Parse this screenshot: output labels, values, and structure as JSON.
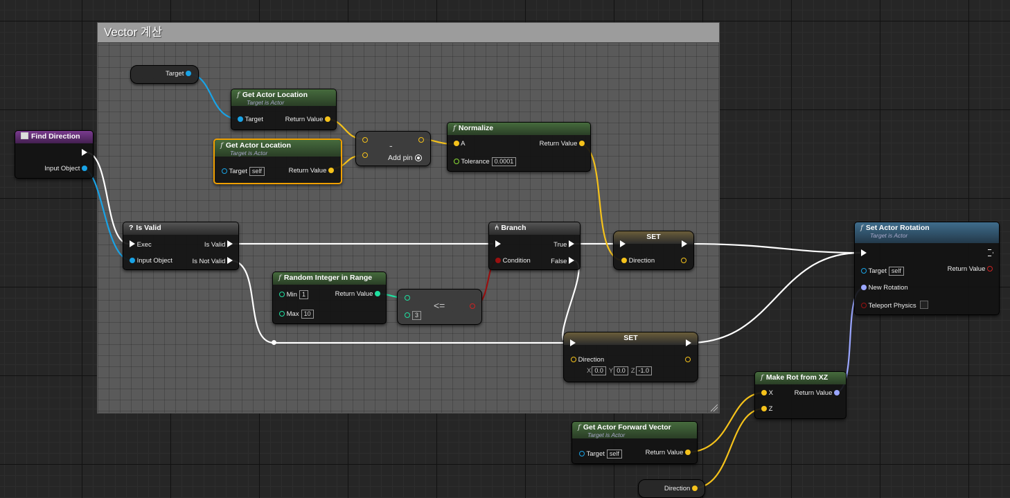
{
  "comment": {
    "title": "Vector 계산"
  },
  "colors": {
    "exec": "#ffffff",
    "object": "#19a3e6",
    "vector": "#f5c21b",
    "bool": "#9a1010",
    "int": "#1fe0a0",
    "float": "#8ce035",
    "rotator": "#9aa6ff"
  },
  "nodes": {
    "find_direction": {
      "title": "Find Direction",
      "input_object": "Input Object"
    },
    "target_var": {
      "label": "Target"
    },
    "get_loc_1": {
      "title": "Get Actor Location",
      "subtitle": "Target is Actor",
      "target": "Target",
      "ret": "Return Value"
    },
    "get_loc_2": {
      "title": "Get Actor Location",
      "subtitle": "Target is Actor",
      "target": "Target",
      "target_val": "self",
      "ret": "Return Value"
    },
    "subtract": {
      "op": "-",
      "add_pin": "Add pin"
    },
    "normalize": {
      "title": "Normalize",
      "a": "A",
      "ret": "Return Value",
      "tolerance": "Tolerance",
      "tolerance_val": "0.0001"
    },
    "is_valid": {
      "title": "Is Valid",
      "exec": "Exec",
      "is_valid": "Is Valid",
      "input_object": "Input Object",
      "is_not_valid": "Is Not Valid"
    },
    "branch": {
      "title": "Branch",
      "true": "True",
      "condition": "Condition",
      "false": "False"
    },
    "set1": {
      "title": "SET",
      "direction": "Direction"
    },
    "random_int": {
      "title": "Random Integer in Range",
      "min": "Min",
      "min_val": "1",
      "ret": "Return Value",
      "max": "Max",
      "max_val": "10"
    },
    "lte": {
      "op": "<=",
      "b_val": "3"
    },
    "set2": {
      "title": "SET",
      "direction": "Direction",
      "x": "X",
      "x_val": "0.0",
      "y": "Y",
      "y_val": "0.0",
      "z": "Z",
      "z_val": "-1.0"
    },
    "set_rotation": {
      "title": "Set Actor Rotation",
      "subtitle": "Target is Actor",
      "target": "Target",
      "target_val": "self",
      "ret": "Return Value",
      "new_rotation": "New Rotation",
      "teleport": "Teleport Physics"
    },
    "make_rot": {
      "title": "Make Rot from XZ",
      "x": "X",
      "ret": "Return Value",
      "z": "Z"
    },
    "forward": {
      "title": "Get Actor Forward Vector",
      "subtitle": "Target is Actor",
      "target": "Target",
      "target_val": "self",
      "ret": "Return Value"
    },
    "direction_var": {
      "label": "Direction"
    }
  }
}
